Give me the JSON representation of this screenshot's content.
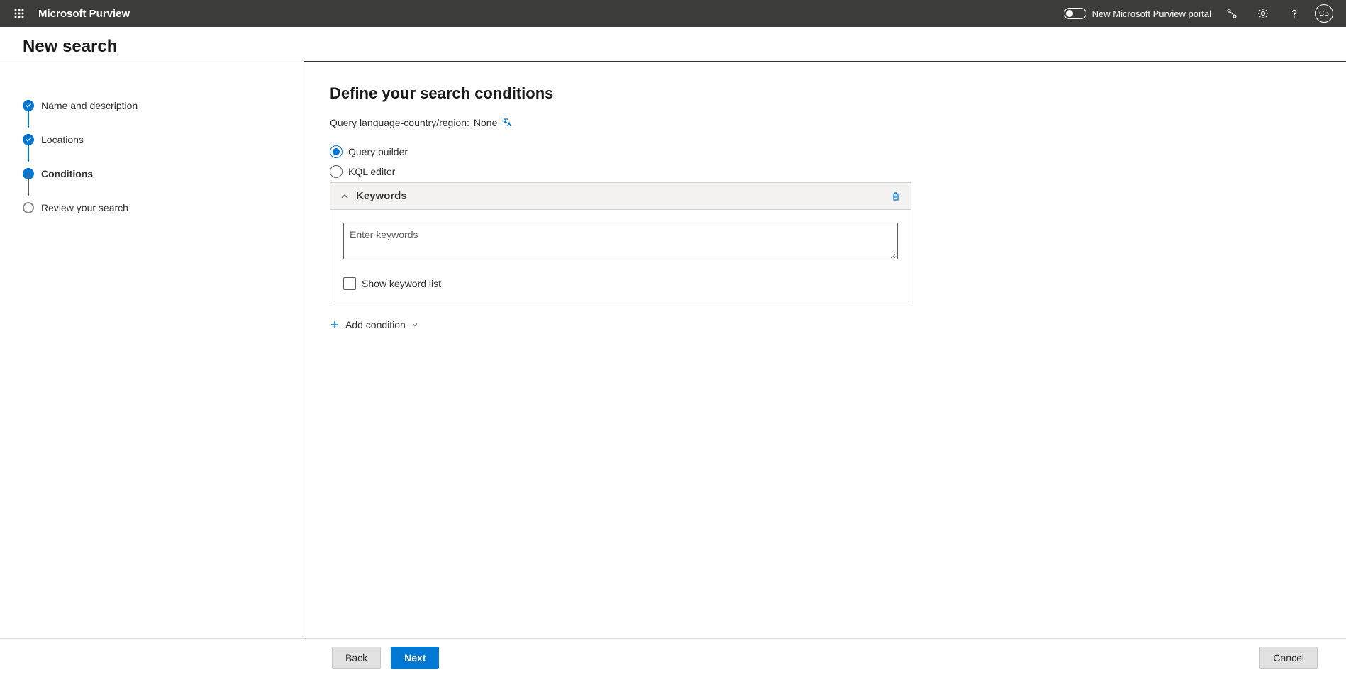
{
  "header": {
    "app_title": "Microsoft Purview",
    "toggle_label": "New Microsoft Purview portal",
    "avatar_initials": "CB"
  },
  "page": {
    "title": "New search"
  },
  "wizard": {
    "steps": [
      {
        "label": "Name and description",
        "state": "done"
      },
      {
        "label": "Locations",
        "state": "done"
      },
      {
        "label": "Conditions",
        "state": "current"
      },
      {
        "label": "Review your search",
        "state": "pending"
      }
    ]
  },
  "panel": {
    "title": "Define your search conditions",
    "query_lang_prefix": "Query language-country/region:",
    "query_lang_value": "None",
    "radio_query_builder": "Query builder",
    "radio_kql_editor": "KQL editor",
    "keywords_title": "Keywords",
    "keywords_placeholder": "Enter keywords",
    "show_keyword_list_label": "Show keyword list",
    "add_condition_label": "Add condition"
  },
  "footer": {
    "back": "Back",
    "next": "Next",
    "cancel": "Cancel"
  }
}
